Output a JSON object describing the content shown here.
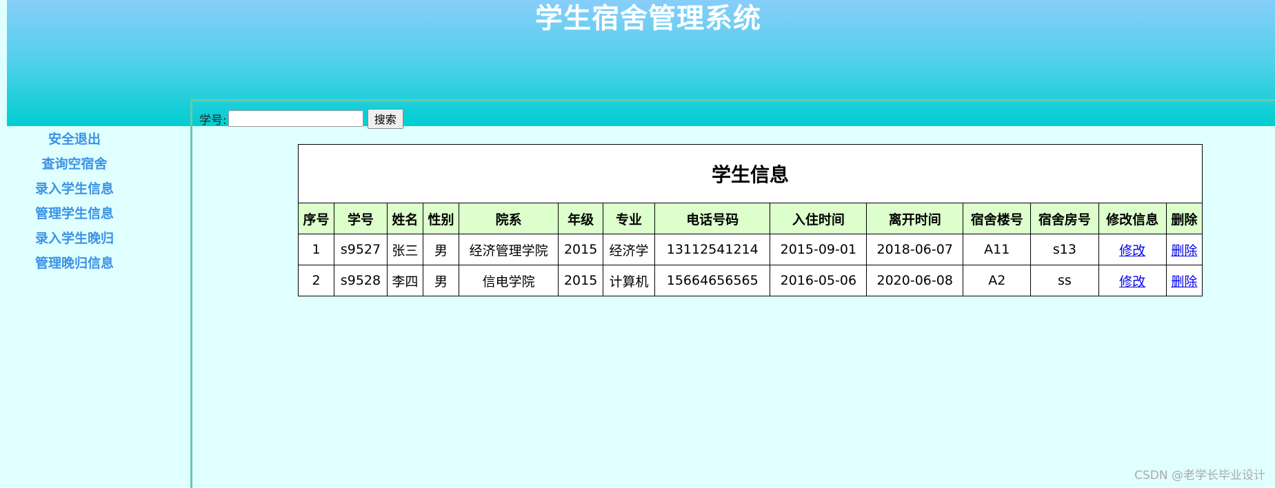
{
  "header": {
    "title": "学生宿舍管理系统"
  },
  "sidebar": {
    "items": [
      {
        "label": "安全退出"
      },
      {
        "label": "查询空宿舍"
      },
      {
        "label": "录入学生信息"
      },
      {
        "label": "管理学生信息"
      },
      {
        "label": "录入学生晚归"
      },
      {
        "label": "管理晚归信息"
      }
    ]
  },
  "search": {
    "label": "学号:",
    "value": "",
    "button": "搜索"
  },
  "table": {
    "title": "学生信息",
    "columns": [
      "序号",
      "学号",
      "姓名",
      "性别",
      "院系",
      "年级",
      "专业",
      "电话号码",
      "入住时间",
      "离开时间",
      "宿舍楼号",
      "宿舍房号",
      "修改信息",
      "删除"
    ],
    "rows": [
      [
        "1",
        "s9527",
        "张三",
        "男",
        "经济管理学院",
        "2015",
        "经济学",
        "13112541214",
        "2015-09-01",
        "2018-06-07",
        "A11",
        "s13",
        "修改",
        "删除"
      ],
      [
        "2",
        "s9528",
        "李四",
        "男",
        "信电学院",
        "2015",
        "计算机",
        "15664656565",
        "2016-05-06",
        "2020-06-08",
        "A2",
        "ss",
        "修改",
        "删除"
      ]
    ]
  },
  "watermark": "CSDN @老学长毕业设计",
  "colors": {
    "sidebar_link": "#3a92e6",
    "header_top": "#87cefa",
    "header_bottom": "#00ced1",
    "page_bg": "#e0ffff",
    "table_header_bg": "#ddffcc"
  }
}
